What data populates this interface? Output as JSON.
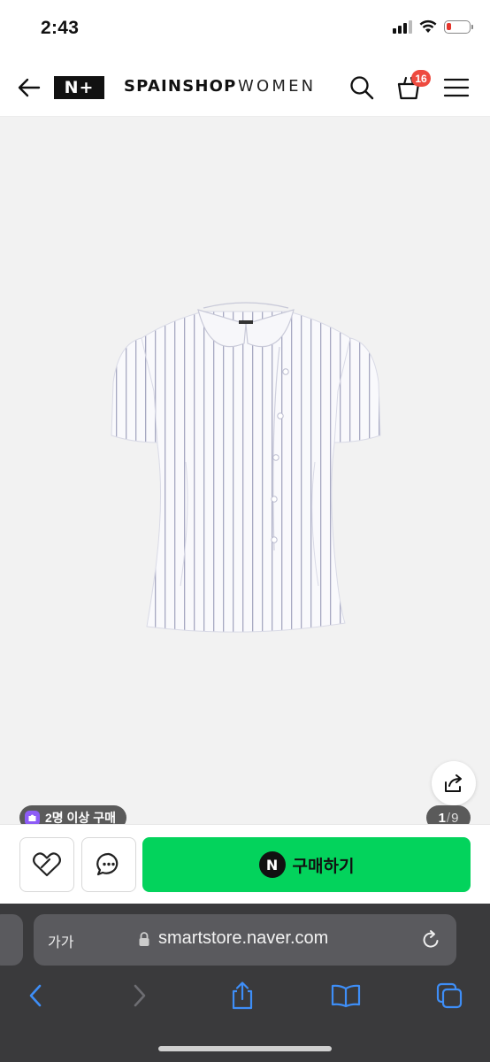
{
  "status_bar": {
    "time": "2:43",
    "battery_level": 0.2,
    "battery_color": "#e5342b"
  },
  "header": {
    "logo": "N+",
    "store_name": "SPAINSHOP",
    "store_sub": "WOMEN",
    "cart_count": "16",
    "badge_color": "#ee4a3f",
    "icons": [
      "back-arrow-icon",
      "search-icon",
      "shopping-bag-icon",
      "hamburger-menu-icon"
    ]
  },
  "product": {
    "image_description_icon": "striped-short-sleeve-blouse-image",
    "promo_badge": "2명 이상 구매",
    "page_current": "1",
    "page_total": "9",
    "background": "#f2f2f2"
  },
  "purchase_bar": {
    "buy_label": "구매하기",
    "npay_label": "N",
    "buy_color": "#03d35c",
    "icons": [
      "heart-icon",
      "chat-icon",
      "share-icon"
    ]
  },
  "browser": {
    "aa_label": "가가",
    "url": "smartstore.naver.com",
    "toolbar_icons": [
      "back-icon",
      "forward-icon",
      "share-icon",
      "bookmarks-icon",
      "tabs-icon"
    ],
    "accent": "#3e8ef7"
  }
}
